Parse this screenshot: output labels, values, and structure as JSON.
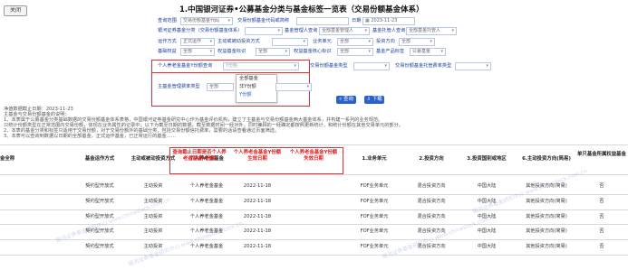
{
  "close_label": "关闭",
  "page_title": "1.中国银河证券•公募基金分类与基金标签一览表（交易份额基金体系）",
  "filters": {
    "query_scope": {
      "label": "查询范围",
      "value": "交易份额基金代码"
    },
    "alt_scope": {
      "label": "交易份额基金代码或简称"
    },
    "date": {
      "label": "日期",
      "value": "2023-11-23"
    },
    "galaxy_category": {
      "label": "银河证券基金分类（交易份额基金体系）"
    },
    "manager_query": {
      "label": "基金管理人查询",
      "value": "全部基金管理人"
    },
    "custodian_query": {
      "label": "基金托管人查询",
      "value": "全部基金托管人"
    },
    "operation_mode": {
      "label": "运作方式",
      "value": "正式运作"
    },
    "active_passive": {
      "label": "主动或被动投资方式"
    },
    "business_unit": {
      "label": "业务单元",
      "value": "全部"
    },
    "invest_direction": {
      "label": "投资方向",
      "value": "全部"
    },
    "fof_tag": {
      "label": "基础权益",
      "value": "全部"
    },
    "equity_tag": {
      "label": "权益基金标识",
      "value": "全部"
    },
    "equity_core_tag": {
      "label": "权益基金核心标识",
      "value": "全部"
    },
    "product_label": {
      "label": "基金产品标签",
      "value": "公募基金"
    },
    "pension_y_query": {
      "label": "个人养老金基金Y份额查询",
      "placeholder": "Y份额"
    },
    "pension_cat_query": {
      "label": "交易份额基金类型",
      "value": ""
    },
    "pension_sub_query": {
      "label": "交易份额基金托管费率类型",
      "value": ""
    },
    "main_mgmt_fee": {
      "label": "主基金管理费率类型",
      "value": "全部"
    }
  },
  "dropdown": {
    "options": [
      "全部基金",
      "非Y份额",
      "Y份额"
    ],
    "selected_index": 2
  },
  "actions": {
    "query": "查询",
    "download": "下载"
  },
  "notes": [
    "净值数据截止日期：2023-11-23",
    "主基金与交易份额基金的说明：",
    "1、本表属于公募基金分类基础数据的交易份额基金体系表格，中国银河证券基金研究中心作为基金评价机构，建立了主基金与交易份额基金两大基金体系，并构建一系列的业务规范。",
    "只统计份额类型在正常范围内交易份额，体现在业务属性的记录中；以下为截至日期的数据，截至数据时间一经对外，同时兼顾的一经确定都按照更新统计，和统计份额在其他交易单元的部分。",
    "2、本表的基金分类和标签只适用于交易份额，对于交易份额外的基础分类、包括交易份额信托费率，需要的话请查看通过页面筛选。",
    "3、本表可以查询到数据以日期的全部基金，正式运作基金，已正常运行的基金……"
  ],
  "table": {
    "headers": [
      "金全称",
      "基金运作方式",
      "主动或被动投资方式",
      "个人养老金基金",
      "查询截止日期是否个人养老金基金Y份额",
      "个人养老金基金Y份额生效日期",
      "个人养老金基金Y份额失效日期",
      "1.业务单元",
      "2.投资方向",
      "3.投资国别或地区",
      "6.主动投资方向(简易)",
      "单只基金所属权益基金"
    ],
    "rows": [
      [
        "契约型开放式",
        "主动投资",
        "个人养老金基金",
        "2022-11-18",
        "FOF业务单元",
        "混合投资方向",
        "中国大陆",
        "其他投资方向(简易)",
        "否"
      ],
      [
        "契约型开放式",
        "主动投资",
        "个人养老金基金",
        "2022-11-18",
        "FOF业务单元",
        "混合投资方向",
        "中国大陆",
        "其他投资方向(简易)",
        "否"
      ],
      [
        "契约型开放式",
        "主动投资",
        "个人养老金基金",
        "2022-11-18",
        "FOF业务单元",
        "混合投资方向",
        "中国大陆",
        "其他投资方向(简易)",
        "否"
      ],
      [
        "契约型开放式",
        "主动投资",
        "个人养老金基金",
        "2022-11-18",
        "FOF业务单元",
        "混合投资方向",
        "中国大陆",
        "其他投资方向(简易)",
        "否"
      ],
      [
        "契约型开放式",
        "主动投资",
        "个人养老金基金",
        "2022-11-18",
        "FOF业务单元",
        "混合投资方向",
        "中国大陆",
        "其他投资方向(简易)",
        "否"
      ]
    ]
  },
  "watermark": "银河证券基金研究中心 www.chinastock.com.cn",
  "colors": {
    "accent": "#2a62c9",
    "highlight": "#e01e1e",
    "label_blue": "#1a3f9a"
  }
}
